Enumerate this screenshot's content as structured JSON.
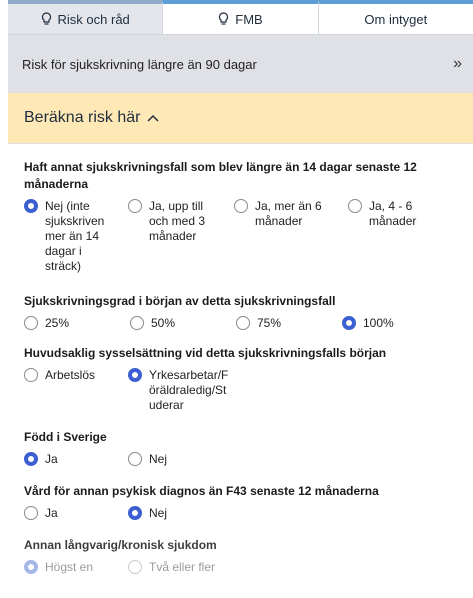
{
  "tabs": [
    {
      "label": "Risk och råd",
      "icon": "lightbulb-icon"
    },
    {
      "label": "FMB",
      "icon": "lightbulb-icon"
    },
    {
      "label": "Om intyget",
      "icon": ""
    }
  ],
  "banner": {
    "text": "Risk för sjukskrivning längre än 90 dagar",
    "expand_glyph": "»"
  },
  "calc": {
    "title": "Beräkna risk här"
  },
  "questions": [
    {
      "label": "Haft annat sjukskrivningsfall som blev längre än 14 dagar senaste 12 månaderna",
      "options": [
        "Nej (inte sjukskriven mer än 14 dagar i sträck)",
        "Ja, upp till och med 3 månader",
        "Ja, mer än 6 månader",
        "Ja, 4 - 6 månader"
      ],
      "selected": 0
    },
    {
      "label": "Sjukskrivningsgrad i början av detta sjukskrivningsfall",
      "options": [
        "25%",
        "50%",
        "75%",
        "100%"
      ],
      "selected": 3
    },
    {
      "label": "Huvudsaklig sysselsättning vid detta sjukskrivningsfalls början",
      "options": [
        "Arbetslös",
        "Yrkesarbetar/Föräldraledig/Studerar"
      ],
      "selected": 1
    },
    {
      "label": "Född i Sverige",
      "options": [
        "Ja",
        "Nej"
      ],
      "selected": 0
    },
    {
      "label": "Vård för annan psykisk diagnos än F43 senaste 12 månaderna",
      "options": [
        "Ja",
        "Nej"
      ],
      "selected": 1
    },
    {
      "label": "Annan långvarig/kronisk sjukdom",
      "options": [
        "Högst en",
        "Två eller fler"
      ],
      "selected": 0
    }
  ],
  "colors": {
    "accent": "#3a5fd0",
    "calc_bg": "#fde8b6",
    "banner_bg": "#dfe1e7"
  }
}
